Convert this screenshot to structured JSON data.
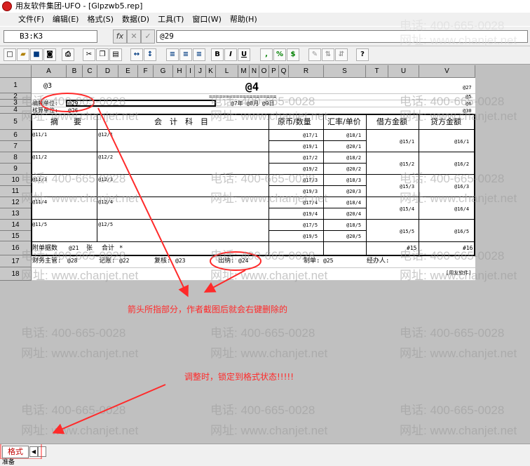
{
  "window": {
    "title": "用友软件集团-UFO - [Glpzwb5.rep]"
  },
  "menu": [
    "文件(F)",
    "编辑(E)",
    "格式(S)",
    "数据(D)",
    "工具(T)",
    "窗口(W)",
    "帮助(H)"
  ],
  "editbar": {
    "cell_ref": "B3:K3",
    "fx_label": "fx",
    "cancel_label": "✕",
    "accept_label": "✓",
    "formula": "@29"
  },
  "toolbar": {
    "bold": "B",
    "italic": "I",
    "underline": "U",
    "comma": ",",
    "percent": "%",
    "currency": "$"
  },
  "columns": [
    "A",
    "B",
    "C",
    "D",
    "E",
    "F",
    "G",
    "H",
    "I",
    "J",
    "K",
    "L",
    "M",
    "N",
    "O",
    "P",
    "Q",
    "R",
    "S",
    "T",
    "U",
    "V"
  ],
  "rows": [
    "1",
    "2",
    "3",
    "4",
    "5",
    "6",
    "7",
    "8",
    "9",
    "10",
    "11",
    "12",
    "13",
    "14",
    "15",
    "16",
    "17",
    "18"
  ],
  "sheet": {
    "r1_left": "@3",
    "r1_title": "@4",
    "r1_right": "@27",
    "r2_right": "@5",
    "r2_rule": "====================",
    "r3_label": "编制单位:",
    "r3_value": "@29",
    "r3_date": "@7年 @8月 @9日",
    "r3_right": "@6",
    "r4_label": "核算单位:",
    "r4_value": "@26",
    "r4_right": "@30",
    "headers": {
      "summary": "摘　　要",
      "account": "会　计　科　目",
      "orig": "原币/数量",
      "rate": "汇率/单价",
      "debit": "借方金额",
      "credit": "贷方金额"
    },
    "lines": [
      {
        "summary": "@11/1",
        "account": "@12/1",
        "orig1": "@17/1",
        "orig2": "@19/1",
        "rate1": "@18/1",
        "rate2": "@20/1",
        "debit": "@15/1",
        "credit": "@16/1"
      },
      {
        "summary": "@11/2",
        "account": "@12/2",
        "orig1": "@17/2",
        "orig2": "@19/2",
        "rate1": "@18/2",
        "rate2": "@20/2",
        "debit": "@15/2",
        "credit": "@16/2"
      },
      {
        "summary": "@11/3",
        "account": "@12/3",
        "orig1": "@17/3",
        "orig2": "@19/3",
        "rate1": "@18/3",
        "rate2": "@20/3",
        "debit": "@15/3",
        "credit": "@16/3"
      },
      {
        "summary": "@11/4",
        "account": "@12/4",
        "orig1": "@17/4",
        "orig2": "@19/4",
        "rate1": "@18/4",
        "rate2": "@20/4",
        "debit": "@15/4",
        "credit": "@16/4"
      },
      {
        "summary": "@11/5",
        "account": "@12/5",
        "orig1": "@17/5",
        "orig2": "@19/5",
        "rate1": "@18/5",
        "rate2": "@20/5",
        "debit": "@15/5",
        "credit": "@16/5"
      }
    ],
    "r16": {
      "attach": "附单据数",
      "attach_val": "@21",
      "zhang": "张",
      "total": "合计",
      "star": "*",
      "debit": "#15",
      "credit": "#16"
    },
    "r17": {
      "finance": "财务主管:",
      "finance_val": "@28",
      "book": "记账:",
      "book_val": "@22",
      "review": "复核:",
      "review_val": "@23",
      "cashier": "出纳:",
      "cashier_val": "@24",
      "maker": "制单:",
      "maker_val": "@25",
      "handler": "经办人:"
    },
    "r18": {
      "brand": "[用友软件]"
    }
  },
  "watermark": {
    "phone": "电话: 400-665-0028",
    "site": "网址: www.chanjet.net"
  },
  "annotations": {
    "note1": "箭头所指部分，作者截图后就会右键删除的",
    "note2": "调整时，锁定到格式状态!!!!!"
  },
  "colors": {
    "annotation": "#ff2a2a",
    "header": "#c8c8c8",
    "background": "#c0c0c0"
  },
  "bottom": {
    "sheet_tab": "格式",
    "status": "准备"
  }
}
